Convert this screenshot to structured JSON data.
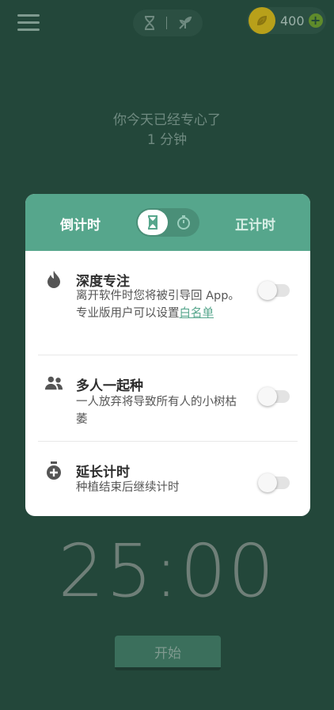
{
  "topbar": {
    "coins": "400",
    "icons": [
      "menu-icon",
      "hourglass-icon",
      "no-plant-icon",
      "coin-icon",
      "add-icon"
    ]
  },
  "focus": {
    "line1": "你今天已经专心了",
    "line2": "1 分钟"
  },
  "modal": {
    "tab_countdown": "倒计时",
    "tab_stopwatch": "正计时",
    "options": [
      {
        "icon": "flame-icon",
        "title": "深度专注",
        "desc1": "离开软件时您将被引导回 App。",
        "desc2": "专业版用户可以设置",
        "link": "白名单",
        "enabled": false
      },
      {
        "icon": "group-icon",
        "title": "多人一起种",
        "desc": "一人放弃将导致所有人的小树枯萎",
        "enabled": false
      },
      {
        "icon": "timer-plus-icon",
        "title": "延长计时",
        "desc": "种植结束后继续计时",
        "enabled": false
      }
    ]
  },
  "timer": "25:00",
  "start_label": "开始",
  "colors": {
    "background": "#23473a",
    "accent": "#56a68c",
    "coin": "#b8a01a"
  }
}
